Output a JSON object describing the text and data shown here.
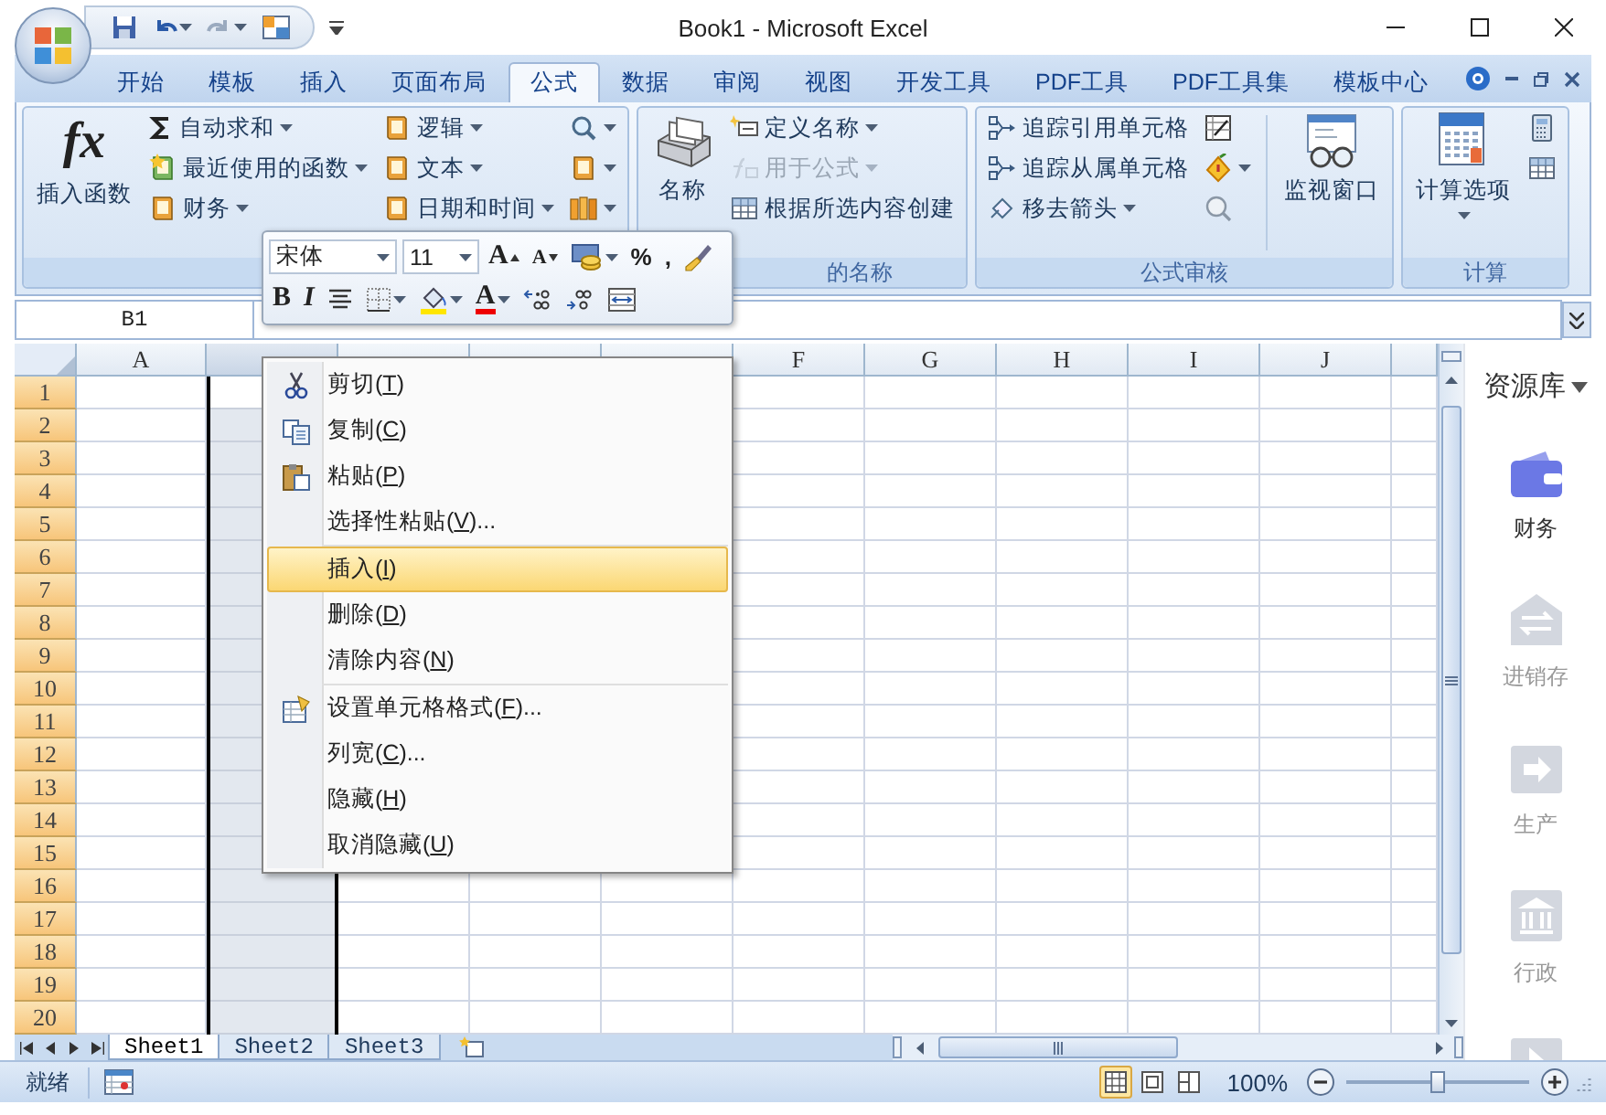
{
  "window": {
    "title": "Book1 - Microsoft Excel"
  },
  "tabs": [
    {
      "label": "开始",
      "selected": false
    },
    {
      "label": "模板",
      "selected": false
    },
    {
      "label": "插入",
      "selected": false
    },
    {
      "label": "页面布局",
      "selected": false
    },
    {
      "label": "公式",
      "selected": true
    },
    {
      "label": "数据",
      "selected": false
    },
    {
      "label": "审阅",
      "selected": false
    },
    {
      "label": "视图",
      "selected": false
    },
    {
      "label": "开发工具",
      "selected": false
    },
    {
      "label": "PDF工具",
      "selected": false
    },
    {
      "label": "PDF工具集",
      "selected": false
    },
    {
      "label": "模板中心",
      "selected": false
    }
  ],
  "ribbon": {
    "groups": [
      {
        "columns": [
          [
            {
              "kind": "fx",
              "glyph": "fx",
              "label": "插入函数",
              "dropdown": false,
              "disabled": false
            }
          ],
          [
            {
              "kind": "sum",
              "label": "自动求和",
              "dropdown": true,
              "disabled": false
            },
            {
              "kind": "star-book",
              "label": "最近使用的函数",
              "dropdown": true,
              "disabled": false
            },
            {
              "kind": "book",
              "label": "财务",
              "dropdown": true,
              "disabled": false
            }
          ],
          [
            {
              "kind": "book",
              "label": "逻辑",
              "dropdown": true,
              "disabled": false
            },
            {
              "kind": "book",
              "label": "文本",
              "dropdown": true,
              "disabled": false
            },
            {
              "kind": "book",
              "label": "日期和时间",
              "dropdown": true,
              "disabled": false
            }
          ],
          [
            {
              "kind": "magnifier",
              "dropdown": true,
              "disabled": false
            },
            {
              "kind": "book",
              "dropdown": true,
              "disabled": false
            },
            {
              "kind": "books",
              "dropdown": true,
              "disabled": false
            }
          ]
        ]
      },
      {
        "label": "的名称",
        "columns": [
          [
            {
              "kind": "cards",
              "label": "名称",
              "dropdown": false,
              "disabled": false
            }
          ],
          [
            {
              "kind": "tag",
              "label": "定义名称",
              "dropdown": true,
              "disabled": false
            },
            {
              "kind": "formula",
              "label": "用于公式",
              "dropdown": true,
              "disabled": true
            },
            {
              "kind": "table",
              "label": "根据所选内容创建",
              "dropdown": false,
              "disabled": false
            }
          ]
        ]
      },
      {
        "label": "公式审核",
        "columns": [
          [
            {
              "kind": "trace",
              "label": "追踪引用单元格",
              "dropdown": false,
              "disabled": false
            },
            {
              "kind": "trace",
              "label": "追踪从属单元格",
              "dropdown": false,
              "disabled": false
            },
            {
              "kind": "eraser",
              "label": "移去箭头",
              "dropdown": true,
              "disabled": false
            }
          ],
          [
            {
              "kind": "sheet",
              "dropdown": false,
              "disabled": false
            },
            {
              "kind": "warning",
              "dropdown": true,
              "disabled": false
            },
            {
              "kind": "evaluate",
              "dropdown": false,
              "disabled": false
            }
          ],
          [
            {
              "kind": "glasses",
              "label": "监视窗口",
              "dropdown": false,
              "disabled": false
            }
          ]
        ]
      },
      {
        "label": "计算",
        "columns": [
          [
            {
              "kind": "calculator",
              "label": "计算选项",
              "dropdown": true,
              "disabled": false
            }
          ],
          [
            {
              "kind": "calculator-small",
              "dropdown": false,
              "disabled": false
            },
            {
              "kind": "table",
              "dropdown": false,
              "disabled": false
            }
          ]
        ]
      }
    ]
  },
  "formula_bar": {
    "name_box": "B1"
  },
  "mini_toolbar": {
    "font": "宋体",
    "size": "11",
    "row1": [
      {
        "kind": "grow",
        "glyph": "A"
      },
      {
        "kind": "shrink",
        "glyph": "A"
      },
      {
        "kind": "currency"
      },
      {
        "kind": "text",
        "glyph": "%"
      },
      {
        "kind": "text",
        "glyph": ","
      },
      {
        "kind": "painter"
      }
    ],
    "row2": [
      {
        "kind": "bold",
        "glyph": "B"
      },
      {
        "kind": "italic",
        "glyph": "I"
      },
      {
        "kind": "center"
      },
      {
        "kind": "border"
      },
      {
        "kind": "fill"
      },
      {
        "kind": "font-color",
        "glyph": "A"
      },
      {
        "kind": "inc-decimal"
      },
      {
        "kind": "dec-decimal"
      },
      {
        "kind": "merge"
      }
    ]
  },
  "grid": {
    "columns": [
      {
        "label": "A",
        "selected": false
      },
      {
        "selected": true
      },
      {
        "selected": false
      },
      {
        "selected": false
      },
      {
        "selected": false
      },
      {
        "label": "F",
        "selected": false
      },
      {
        "label": "G",
        "selected": false
      },
      {
        "label": "H",
        "selected": false
      },
      {
        "label": "I",
        "selected": false
      },
      {
        "label": "J",
        "selected": false
      }
    ],
    "rows": [
      "1",
      "2",
      "3",
      "4",
      "5",
      "6",
      "7",
      "8",
      "9",
      "10",
      "11",
      "12",
      "13",
      "14",
      "15",
      "16",
      "17",
      "18",
      "19",
      "20"
    ]
  },
  "context_menu": {
    "sections": [
      [
        {
          "kind": "cut",
          "before": "剪切(",
          "accelerator": "T",
          "after": ")",
          "selected": false
        },
        {
          "kind": "copy",
          "before": "复制(",
          "accelerator": "C",
          "after": ")",
          "selected": false
        },
        {
          "kind": "paste",
          "before": "粘贴(",
          "accelerator": "P",
          "after": ")",
          "selected": false
        },
        {
          "kind": "none",
          "before": "选择性粘贴(",
          "accelerator": "V",
          "after": ")...",
          "selected": false
        }
      ],
      [
        {
          "kind": "none",
          "before": "插入(",
          "accelerator": "I",
          "after": ")",
          "selected": true
        },
        {
          "kind": "none",
          "before": "删除(",
          "accelerator": "D",
          "after": ")",
          "selected": false
        },
        {
          "kind": "none",
          "before": "清除内容(",
          "accelerator": "N",
          "after": ")",
          "selected": false
        }
      ],
      [
        {
          "kind": "format",
          "before": "设置单元格格式(",
          "accelerator": "F",
          "after": ")...",
          "selected": false
        },
        {
          "kind": "none",
          "before": "列宽(",
          "accelerator": "C",
          "after": ")...",
          "selected": false
        },
        {
          "kind": "none",
          "before": "隐藏(",
          "accelerator": "H",
          "after": ")",
          "selected": false
        },
        {
          "kind": "none",
          "before": "取消隐藏(",
          "accelerator": "U",
          "after": ")",
          "selected": false
        }
      ]
    ]
  },
  "sheets": [
    {
      "label": "Sheet1",
      "selected": true
    },
    {
      "label": "Sheet2",
      "selected": false
    },
    {
      "label": "Sheet3",
      "selected": false
    }
  ],
  "sidebar": {
    "title": "资源库",
    "items": [
      {
        "kind": "wallet",
        "label": "财务",
        "selected": true
      },
      {
        "kind": "exchange",
        "label": "进销存",
        "selected": false
      },
      {
        "kind": "arrow",
        "label": "生产",
        "selected": false
      },
      {
        "kind": "bank",
        "label": "行政",
        "selected": false
      },
      {
        "kind": "tile",
        "selected": false
      }
    ]
  },
  "status_bar": {
    "text": "就绪",
    "views": [
      {
        "kind": "normal",
        "selected": true
      },
      {
        "kind": "layout",
        "selected": false
      },
      {
        "kind": "break",
        "selected": false
      }
    ],
    "zoom": {
      "reading": "100%",
      "level": 0.5
    }
  }
}
